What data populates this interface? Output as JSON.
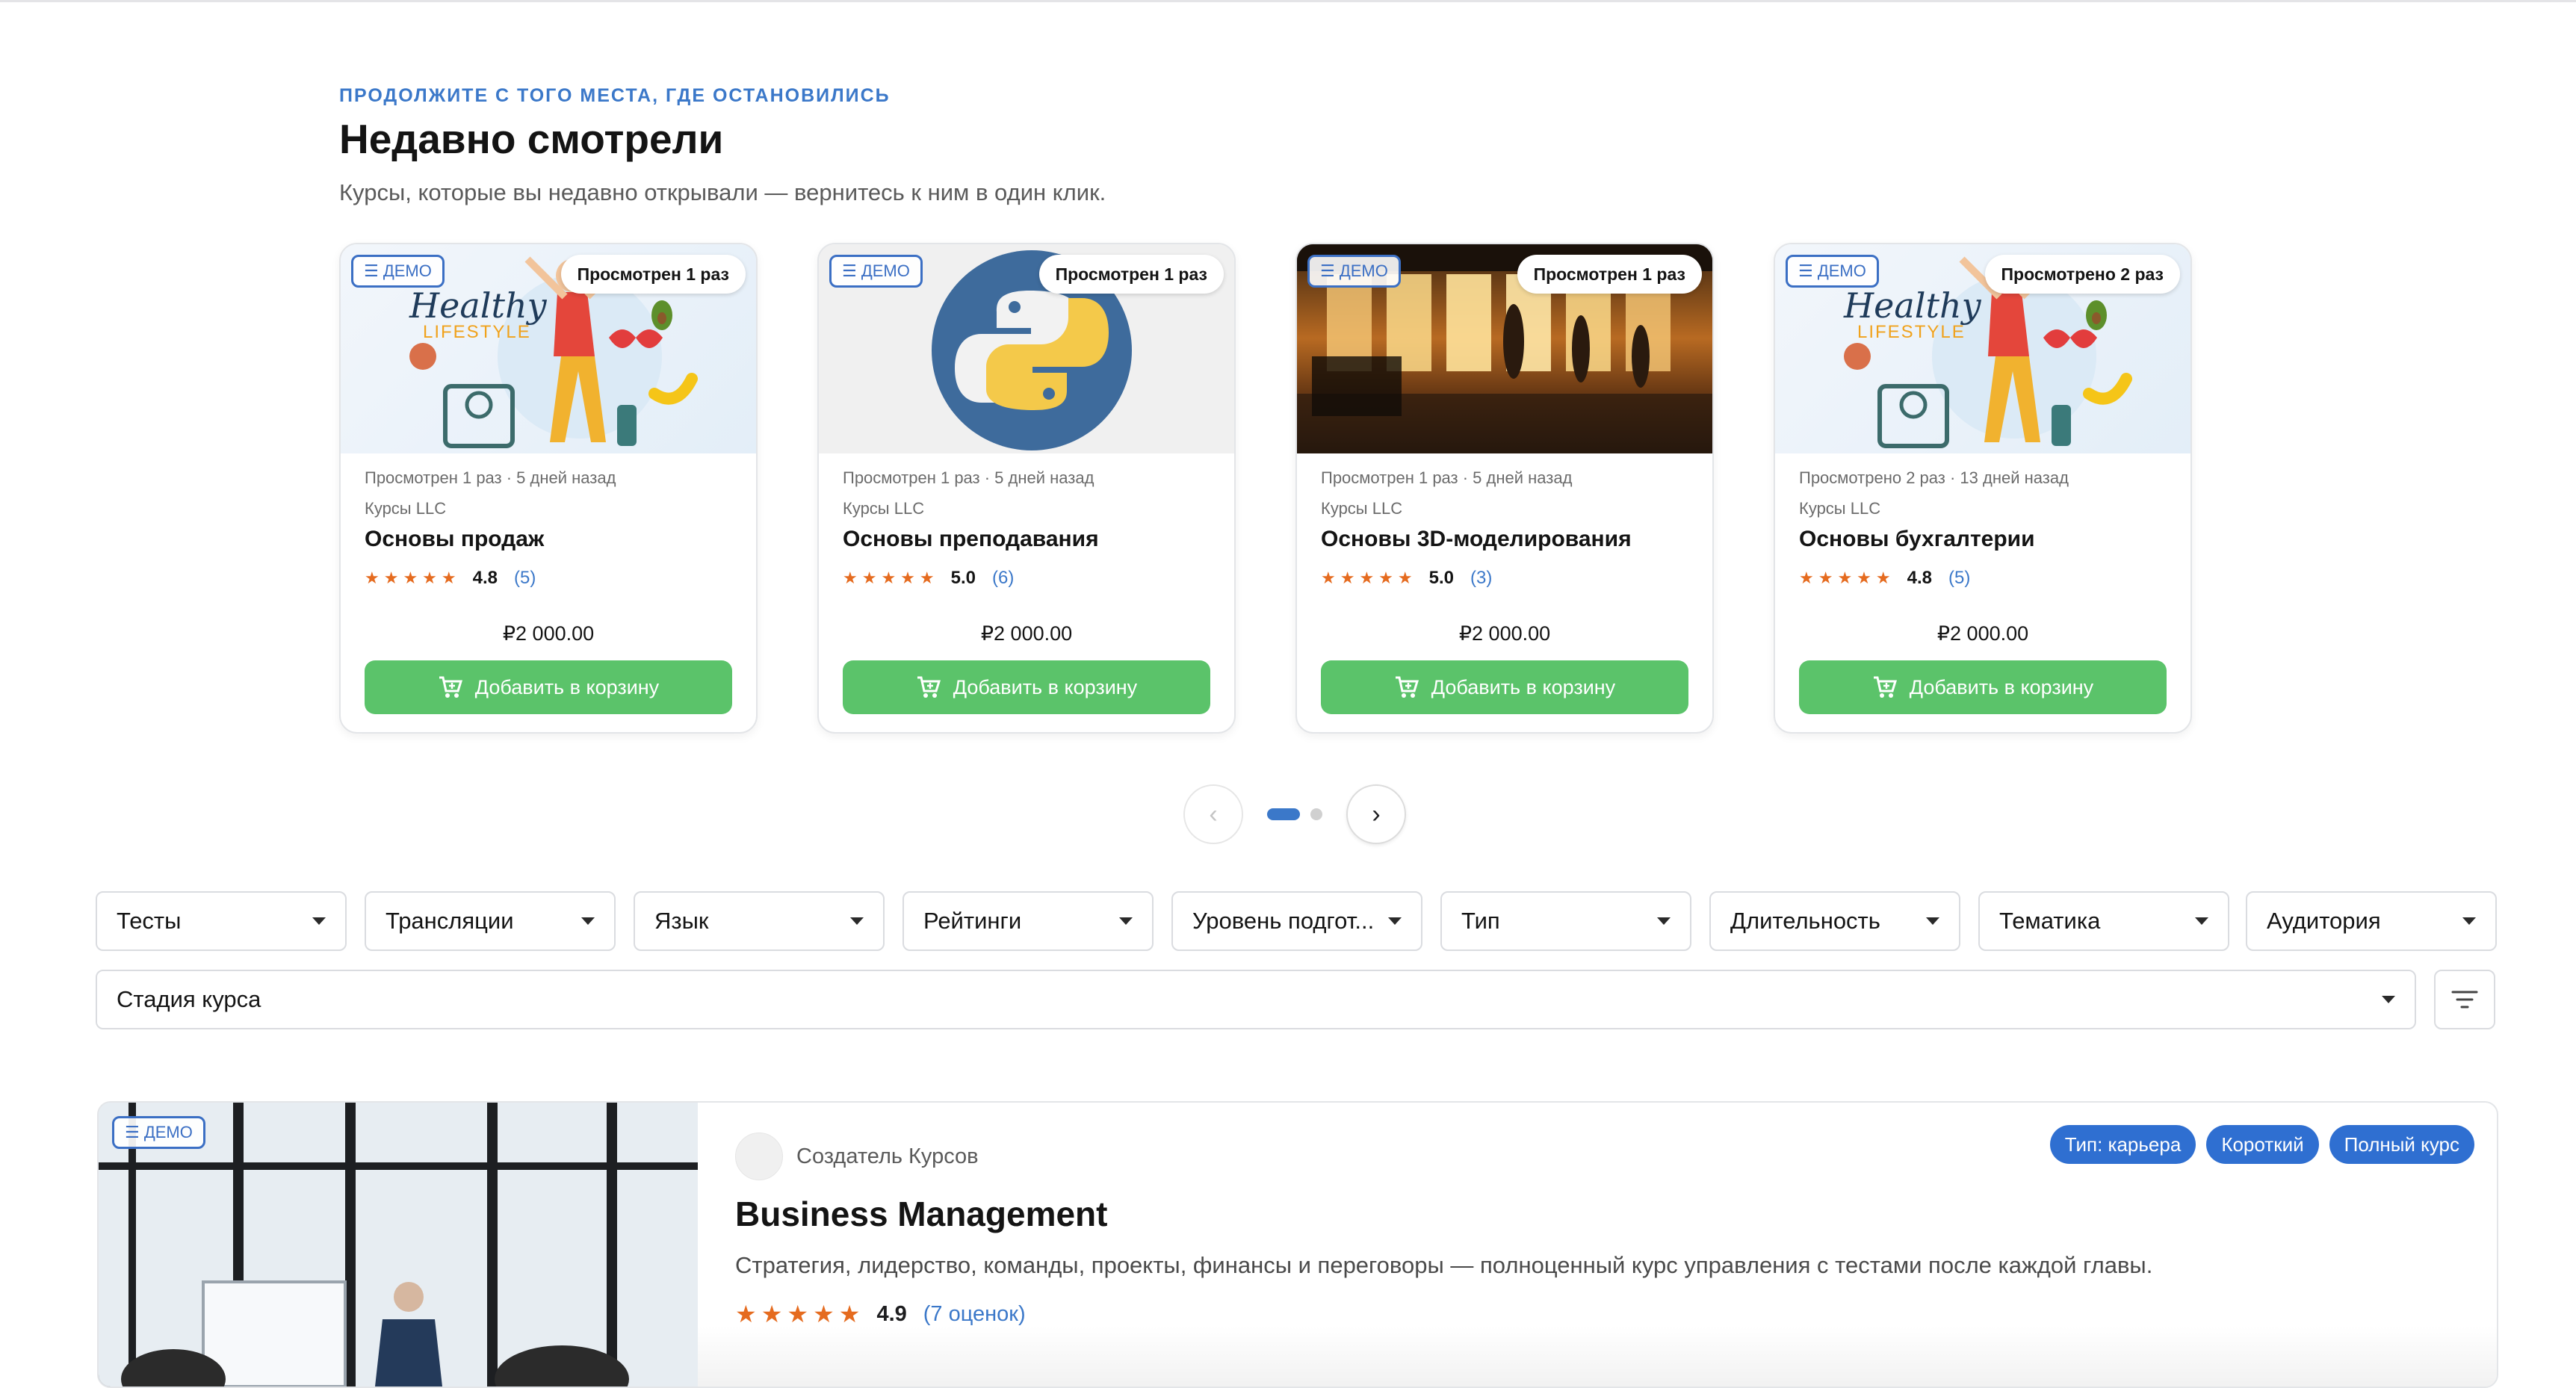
{
  "recent": {
    "eyebrow": "ПРОДОЛЖИТЕ С ТОГО МЕСТА, ГДЕ ОСТАНОВИЛИСЬ",
    "title": "Недавно смотрели",
    "subtitle": "Курсы, которые вы недавно открывали — вернитесь к ним в один клик.",
    "cards": [
      {
        "demo": "☰ ДЕМО",
        "views_badge": "Просмотрен 1 раз",
        "meta": "Просмотрен 1 раз · 5 дней назад",
        "org": "Курсы LLC",
        "title": "Основы продаж",
        "rating": "4.8",
        "count": "(5)",
        "price": "₽2 000.00",
        "button": "Добавить в корзину",
        "thumb_overlay": "Healthy",
        "thumb_overlay2": "LIFESTYLE"
      },
      {
        "demo": "☰ ДЕМО",
        "views_badge": "Просмотрен 1 раз",
        "meta": "Просмотрен 1 раз · 5 дней назад",
        "org": "Курсы LLC",
        "title": "Основы преподавания",
        "rating": "5.0",
        "count": "(6)",
        "price": "₽2 000.00",
        "button": "Добавить в корзину"
      },
      {
        "demo": "☰ ДЕМО",
        "views_badge": "Просмотрен 1 раз",
        "meta": "Просмотрен 1 раз · 5 дней назад",
        "org": "Курсы LLC",
        "title": "Основы 3D-моделирования",
        "rating": "5.0",
        "count": "(3)",
        "price": "₽2 000.00",
        "button": "Добавить в корзину"
      },
      {
        "demo": "☰ ДЕМО",
        "views_badge": "Просмотрено 2 раз",
        "meta": "Просмотрено 2 раз · 13 дней назад",
        "org": "Курсы LLC",
        "title": "Основы бухгалтерии",
        "rating": "4.8",
        "count": "(5)",
        "price": "₽2 000.00",
        "button": "Добавить в корзину",
        "thumb_overlay": "Healthy",
        "thumb_overlay2": "LIFESTYLE"
      }
    ],
    "stars": "★★★★★",
    "pager": {
      "prev": "‹",
      "next": "›",
      "active_page": 1,
      "total_pages": 2
    }
  },
  "filters": {
    "items": [
      "Тесты",
      "Трансляции",
      "Язык",
      "Рейтинги",
      "Уровень подгот...",
      "Тип",
      "Длительность",
      "Тематика",
      "Аудитория"
    ],
    "stage": "Стадия курса"
  },
  "featured": {
    "demo": "☰ ДЕМО",
    "creator": "Создатель Курсов",
    "tags": [
      "Тип: карьера",
      "Короткий",
      "Полный курс"
    ],
    "title": "Business Management",
    "description": "Стратегия, лидерство, команды, проекты, финансы и переговоры — полноценный курс управления с тестами после каждой главы.",
    "stars": "★★★★★",
    "rating": "4.9",
    "count": "(7 оценок)"
  },
  "colors": {
    "accent": "#3b78c9",
    "cart": "#5bc36a",
    "star": "#e56b1f",
    "tag": "#2f6fd1"
  }
}
